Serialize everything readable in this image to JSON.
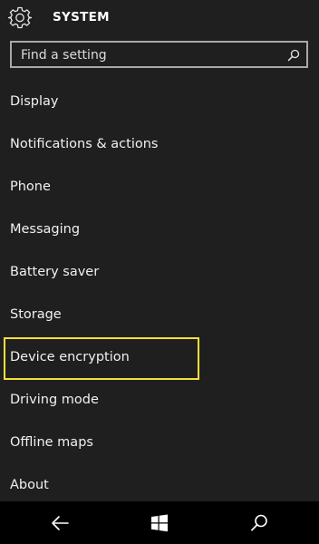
{
  "header": {
    "title": "SYSTEM",
    "icon": "gear-icon"
  },
  "search": {
    "placeholder": "Find a setting",
    "value": "",
    "icon": "search-icon"
  },
  "menu": {
    "items": [
      {
        "label": "Display"
      },
      {
        "label": "Notifications & actions"
      },
      {
        "label": "Phone"
      },
      {
        "label": "Messaging"
      },
      {
        "label": "Battery saver"
      },
      {
        "label": "Storage"
      },
      {
        "label": "Device encryption",
        "highlighted": true
      },
      {
        "label": "Driving mode"
      },
      {
        "label": "Offline maps"
      },
      {
        "label": "About"
      }
    ]
  },
  "navbar": {
    "buttons": [
      "back-arrow-icon",
      "windows-start-icon",
      "search-icon"
    ]
  },
  "colors": {
    "background": "#1f1f1f",
    "navbar": "#000000",
    "highlight_border": "#f5e13a",
    "search_border": "#a8a8a8"
  }
}
